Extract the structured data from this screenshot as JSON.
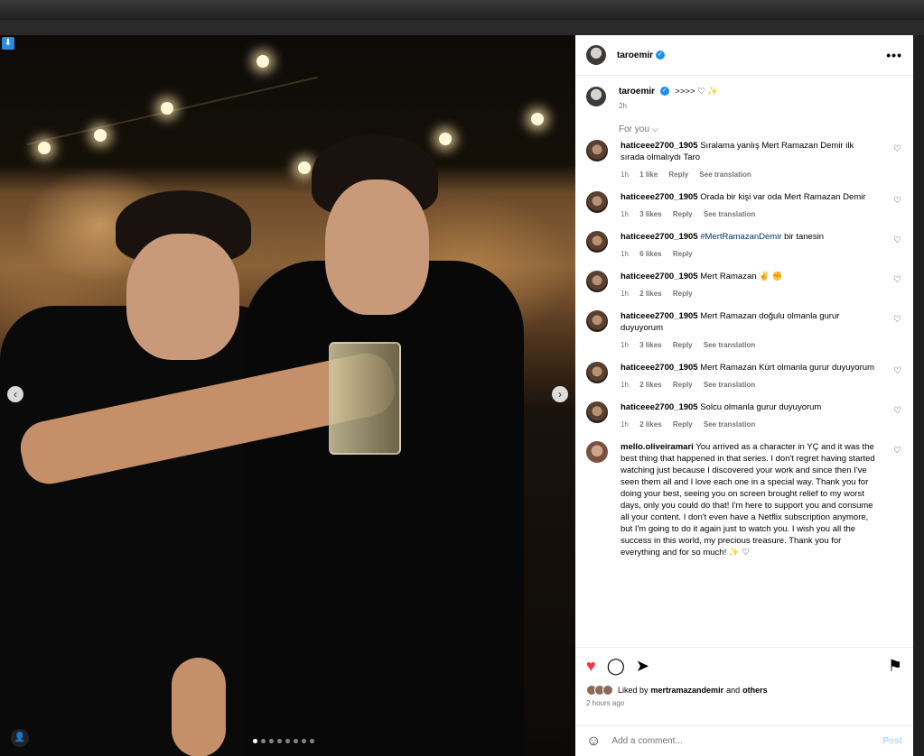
{
  "photo": {
    "download_icon": "download-icon",
    "carousel_dots": 8,
    "active_dot": 0
  },
  "post": {
    "author": "taroemir",
    "caption_author": "taroemir",
    "caption_text": ">>>> ♡ ✨",
    "caption_time": "2h",
    "more_label": "•••",
    "for_you_label": "For you ⌵"
  },
  "comments": [
    {
      "user": "haticeee2700_1905",
      "text": "Sıralama yanlış Mert Ramazan Demir ilk sırada olmalıydı Taro",
      "time": "1h",
      "likes": "1 like",
      "reply": "Reply",
      "translate": "See translation"
    },
    {
      "user": "haticeee2700_1905",
      "text": "Orada bir kişi var oda Mert Ramazan Demir",
      "time": "1h",
      "likes": "3 likes",
      "reply": "Reply",
      "translate": "See translation"
    },
    {
      "user": "haticeee2700_1905",
      "hashtag": "#MertRamazanDemir",
      "text": "bir tanesin",
      "time": "1h",
      "likes": "6 likes",
      "reply": "Reply",
      "translate": ""
    },
    {
      "user": "haticeee2700_1905",
      "text": "Mert Ramazan ✌️ ✊",
      "time": "1h",
      "likes": "2 likes",
      "reply": "Reply",
      "translate": ""
    },
    {
      "user": "haticeee2700_1905",
      "text": "Mert Ramazan doğulu olmanla gurur duyuyorum",
      "time": "1h",
      "likes": "3 likes",
      "reply": "Reply",
      "translate": "See translation"
    },
    {
      "user": "haticeee2700_1905",
      "text": "Mert Ramazan Kürt olmanla gurur duyuyorum",
      "time": "1h",
      "likes": "2 likes",
      "reply": "Reply",
      "translate": "See translation"
    },
    {
      "user": "haticeee2700_1905",
      "text": "Solcu olmanla gurur duyuyorum",
      "time": "1h",
      "likes": "2 likes",
      "reply": "Reply",
      "translate": "See translation"
    },
    {
      "user": "mello.oliveiramari",
      "text": "You arrived as a character in YÇ and it was the best thing that happened in that series. I don't regret having started watching just because I discovered your work and since then I've seen them all and I love each one in a special way. Thank you for doing your best, seeing you on screen brought relief to my worst days, only you could do that! I'm here to support you and consume all your content. I don't even have a Netflix subscription anymore, but I'm going to do it again just to watch you. I wish you all the success in this world, my precious treasure. Thank you for everything and for so much! ✨ ♡",
      "time": "",
      "likes": "",
      "reply": "",
      "translate": ""
    }
  ],
  "actions": {
    "liked_prefix": "Liked by",
    "liked_user": "mertramazandemir",
    "liked_and": "and",
    "liked_others": "others",
    "post_time": "2 hours ago",
    "like_color": "#ff3040"
  },
  "add_comment": {
    "placeholder": "Add a comment...",
    "post_label": "Post"
  }
}
